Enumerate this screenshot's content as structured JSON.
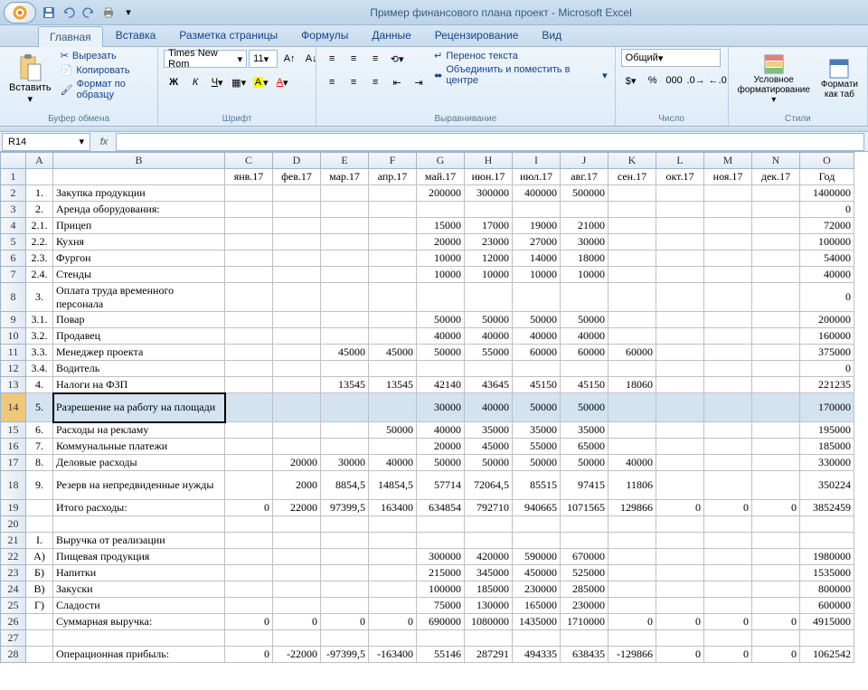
{
  "title": "Пример финансового плана проект - Microsoft Excel",
  "tabs": [
    "Главная",
    "Вставка",
    "Разметка страницы",
    "Формулы",
    "Данные",
    "Рецензирование",
    "Вид"
  ],
  "clipboard": {
    "paste": "Вставить",
    "cut": "Вырезать",
    "copy": "Копировать",
    "format_painter": "Формат по образцу",
    "title": "Буфер обмена"
  },
  "font": {
    "name": "Times New Rom",
    "size": "11",
    "title": "Шрифт"
  },
  "alignment": {
    "wrap": "Перенос текста",
    "merge": "Объединить и поместить в центре",
    "title": "Выравнивание"
  },
  "number": {
    "format": "Общий",
    "title": "Число"
  },
  "styles": {
    "conditional": "Условное форматирование",
    "table": "Формати как таб",
    "title": "Стили"
  },
  "namebox": "R14",
  "columns": [
    "",
    "A",
    "B",
    "C",
    "D",
    "E",
    "F",
    "G",
    "H",
    "I",
    "J",
    "K",
    "L",
    "M",
    "N",
    "O"
  ],
  "headers": {
    "C": "янв.17",
    "D": "фев.17",
    "E": "мар.17",
    "F": "апр.17",
    "G": "май.17",
    "H": "июн.17",
    "I": "июл.17",
    "J": "авг.17",
    "K": "сен.17",
    "L": "окт.17",
    "M": "ноя.17",
    "N": "дек.17",
    "O": "Год"
  },
  "rows": [
    {
      "n": 1,
      "A": "",
      "B": "",
      "vals": {}
    },
    {
      "n": 2,
      "A": "1.",
      "B": "Закупка продукции",
      "vals": {
        "G": "200000",
        "H": "300000",
        "I": "400000",
        "J": "500000",
        "O": "1400000"
      }
    },
    {
      "n": 3,
      "A": "2.",
      "B": "Аренда оборудования:",
      "vals": {
        "O": "0"
      }
    },
    {
      "n": 4,
      "A": "2.1.",
      "B": "Прицеп",
      "vals": {
        "G": "15000",
        "H": "17000",
        "I": "19000",
        "J": "21000",
        "O": "72000"
      }
    },
    {
      "n": 5,
      "A": "2.2.",
      "B": "Кухня",
      "vals": {
        "G": "20000",
        "H": "23000",
        "I": "27000",
        "J": "30000",
        "O": "100000"
      }
    },
    {
      "n": 6,
      "A": "2.3.",
      "B": "Фургон",
      "vals": {
        "G": "10000",
        "H": "12000",
        "I": "14000",
        "J": "18000",
        "O": "54000"
      }
    },
    {
      "n": 7,
      "A": "2.4.",
      "B": "Стенды",
      "vals": {
        "G": "10000",
        "H": "10000",
        "I": "10000",
        "J": "10000",
        "O": "40000"
      }
    },
    {
      "n": 8,
      "A": "3.",
      "B": "Оплата труда временного персонала",
      "tall": true,
      "vals": {
        "O": "0"
      }
    },
    {
      "n": 9,
      "A": "3.1.",
      "B": "Повар",
      "vals": {
        "G": "50000",
        "H": "50000",
        "I": "50000",
        "J": "50000",
        "O": "200000"
      }
    },
    {
      "n": 10,
      "A": "3.2.",
      "B": "Продавец",
      "vals": {
        "G": "40000",
        "H": "40000",
        "I": "40000",
        "J": "40000",
        "O": "160000"
      }
    },
    {
      "n": 11,
      "A": "3.3.",
      "B": "Менеджер проекта",
      "vals": {
        "E": "45000",
        "F": "45000",
        "G": "50000",
        "H": "55000",
        "I": "60000",
        "J": "60000",
        "K": "60000",
        "O": "375000"
      }
    },
    {
      "n": 12,
      "A": "3.4.",
      "B": "Водитель",
      "vals": {
        "O": "0"
      }
    },
    {
      "n": 13,
      "A": "4.",
      "B": "Налоги на ФЗП",
      "vals": {
        "E": "13545",
        "F": "13545",
        "G": "42140",
        "H": "43645",
        "I": "45150",
        "J": "45150",
        "K": "18060",
        "O": "221235"
      }
    },
    {
      "n": 14,
      "A": "5.",
      "B": "Разрешение на работу на площади",
      "tall": true,
      "sel": true,
      "vals": {
        "G": "30000",
        "H": "40000",
        "I": "50000",
        "J": "50000",
        "O": "170000"
      }
    },
    {
      "n": 15,
      "A": "6.",
      "B": "Расходы на рекламу",
      "vals": {
        "F": "50000",
        "G": "40000",
        "H": "35000",
        "I": "35000",
        "J": "35000",
        "O": "195000"
      }
    },
    {
      "n": 16,
      "A": "7.",
      "B": "Коммунальные платежи",
      "vals": {
        "G": "20000",
        "H": "45000",
        "I": "55000",
        "J": "65000",
        "O": "185000"
      }
    },
    {
      "n": 17,
      "A": "8.",
      "B": "Деловые расходы",
      "vals": {
        "D": "20000",
        "E": "30000",
        "F": "40000",
        "G": "50000",
        "H": "50000",
        "I": "50000",
        "J": "50000",
        "K": "40000",
        "O": "330000"
      }
    },
    {
      "n": 18,
      "A": "9.",
      "B": "Резерв на непредвиденные нужды",
      "tall": true,
      "vals": {
        "D": "2000",
        "E": "8854,5",
        "F": "14854,5",
        "G": "57714",
        "H": "72064,5",
        "I": "85515",
        "J": "97415",
        "K": "11806",
        "O": "350224"
      }
    },
    {
      "n": 19,
      "A": "",
      "B": "Итого расходы:",
      "vals": {
        "C": "0",
        "D": "22000",
        "E": "97399,5",
        "F": "163400",
        "G": "634854",
        "H": "792710",
        "I": "940665",
        "J": "1071565",
        "K": "129866",
        "L": "0",
        "M": "0",
        "N": "0",
        "O": "3852459"
      }
    },
    {
      "n": 20,
      "A": "",
      "B": "",
      "vals": {}
    },
    {
      "n": 21,
      "A": "I.",
      "B": "Выручка от реализации",
      "vals": {}
    },
    {
      "n": 22,
      "A": "А)",
      "B": "Пищевая продукция",
      "vals": {
        "G": "300000",
        "H": "420000",
        "I": "590000",
        "J": "670000",
        "O": "1980000"
      }
    },
    {
      "n": 23,
      "A": "Б)",
      "B": "Напитки",
      "vals": {
        "G": "215000",
        "H": "345000",
        "I": "450000",
        "J": "525000",
        "O": "1535000"
      }
    },
    {
      "n": 24,
      "A": "В)",
      "B": "Закуски",
      "vals": {
        "G": "100000",
        "H": "185000",
        "I": "230000",
        "J": "285000",
        "O": "800000"
      }
    },
    {
      "n": 25,
      "A": "Г)",
      "B": "Сладости",
      "vals": {
        "G": "75000",
        "H": "130000",
        "I": "165000",
        "J": "230000",
        "O": "600000"
      }
    },
    {
      "n": 26,
      "A": "",
      "B": "Суммарная выручка:",
      "vals": {
        "C": "0",
        "D": "0",
        "E": "0",
        "F": "0",
        "G": "690000",
        "H": "1080000",
        "I": "1435000",
        "J": "1710000",
        "K": "0",
        "L": "0",
        "M": "0",
        "N": "0",
        "O": "4915000"
      }
    },
    {
      "n": 27,
      "A": "",
      "B": "",
      "vals": {}
    },
    {
      "n": 28,
      "A": "",
      "B": "Операционная прибыль:",
      "vals": {
        "C": "0",
        "D": "-22000",
        "E": "-97399,5",
        "F": "-163400",
        "G": "55146",
        "H": "287291",
        "I": "494335",
        "J": "638435",
        "K": "-129866",
        "L": "0",
        "M": "0",
        "N": "0",
        "O": "1062542"
      }
    }
  ]
}
